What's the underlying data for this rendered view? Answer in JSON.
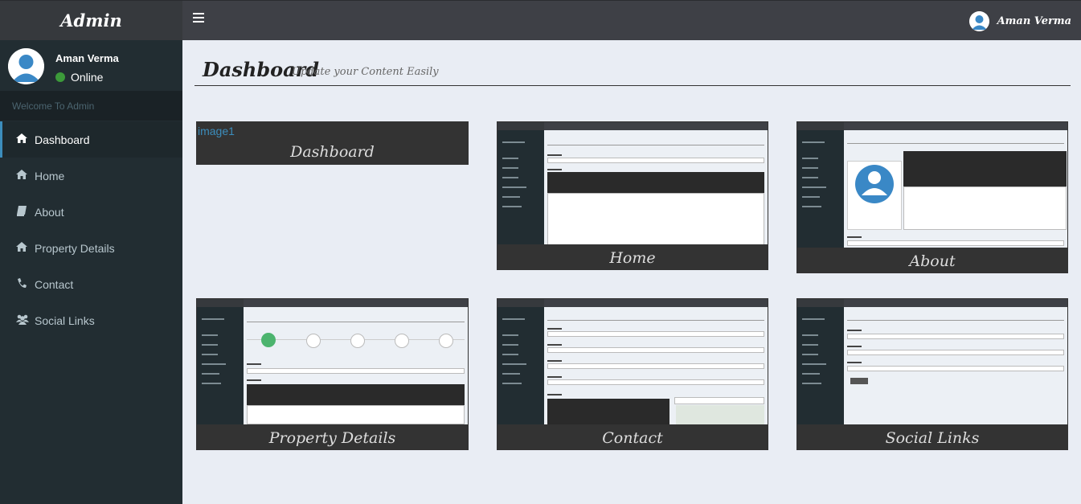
{
  "app": {
    "brand": "Admin"
  },
  "topbar": {
    "user_name": "Aman Verma"
  },
  "sidebar": {
    "user_name": "Aman Verma",
    "status": "Online",
    "welcome": "Welcome To Admin",
    "items": [
      {
        "label": "Dashboard",
        "icon": "home-icon"
      },
      {
        "label": "Home",
        "icon": "home-icon"
      },
      {
        "label": "About",
        "icon": "book-icon"
      },
      {
        "label": "Property Details",
        "icon": "home-icon"
      },
      {
        "label": "Contact",
        "icon": "phone-icon"
      },
      {
        "label": "Social Links",
        "icon": "users-icon"
      }
    ]
  },
  "header": {
    "title": "Dashboard",
    "subtitle": "Update your Content Easily"
  },
  "cards": [
    {
      "caption": "Dashboard",
      "image_alt": "image1"
    },
    {
      "caption": "Home"
    },
    {
      "caption": "About"
    },
    {
      "caption": "Property Details"
    },
    {
      "caption": "Contact"
    },
    {
      "caption": "Social Links"
    }
  ],
  "colors": {
    "accent": "#3c8dbc",
    "sidebar": "#222d32",
    "topbar": "#3e4046",
    "online": "#3c9a3a"
  }
}
